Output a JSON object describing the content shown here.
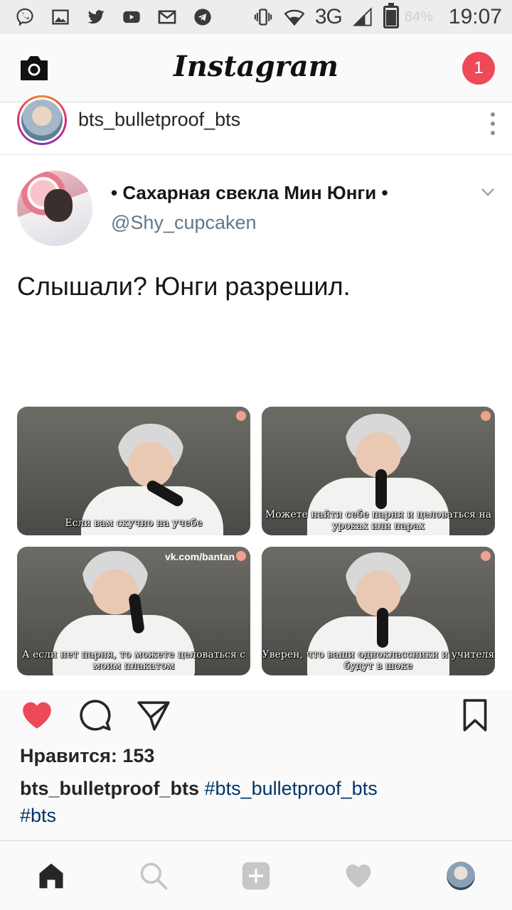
{
  "status_bar": {
    "network": "3G",
    "battery_percent": "84%",
    "battery_level": 0.84,
    "time": "19:07",
    "left_icons": [
      "viber-icon",
      "gallery-icon",
      "twitter-icon",
      "youtube-icon",
      "gmail-icon",
      "telegram-icon"
    ],
    "right_icons": [
      "vibrate-icon",
      "wifi-icon",
      "signal-icon",
      "battery-icon"
    ]
  },
  "app_bar": {
    "logo": "Instagram",
    "notification_count": "1",
    "camera_icon": "camera-icon"
  },
  "post": {
    "username": "bts_bulletproof_bts",
    "tweet": {
      "display_name": "• Сахарная свекла Мин Юнги •",
      "handle": "@Shy_cupcaken",
      "text": "Слышали? Юнги разрешил.",
      "panels": [
        {
          "caption": "Если вам скучно на учебе",
          "watermark": ""
        },
        {
          "caption": "Можете найти себе парня и целоваться на уроках или парах",
          "watermark": ""
        },
        {
          "caption": "А если нет парня, то можете целоваться с моим плакатом",
          "watermark": "vk.com/bantan"
        },
        {
          "caption": "Уверен, что ваши одноклассники и учителя будут в шоке",
          "watermark": ""
        }
      ]
    },
    "likes": "Нравится: 153",
    "caption_user": "bts_bulletproof_bts",
    "hashtags": [
      "#bts_bulletproof_bts",
      "#bts"
    ]
  },
  "colors": {
    "like_red": "#ed4956",
    "hashtag": "#003569",
    "notification": "#ed4956"
  },
  "bottom_nav": [
    "home-icon",
    "search-icon",
    "add-icon",
    "heart-icon",
    "profile-avatar"
  ]
}
